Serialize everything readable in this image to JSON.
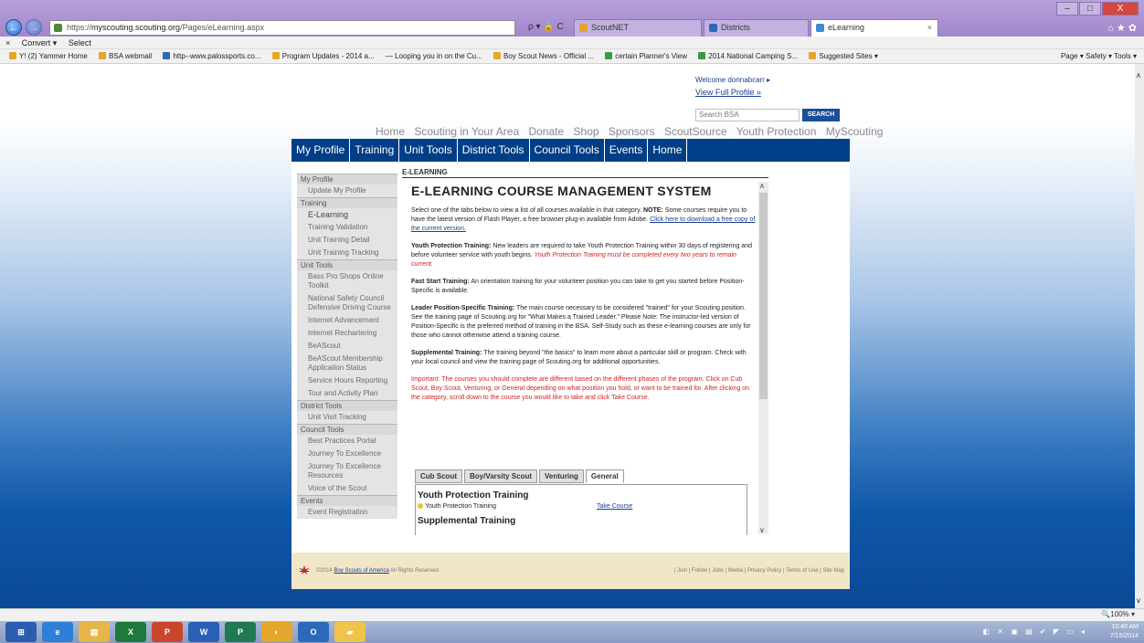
{
  "browser": {
    "url_prefix": "https://",
    "url_domain": "myscouting.scouting.org",
    "url_path": "/Pages/eLearning.aspx",
    "url_controls": "ρ ▾ 🔒 C",
    "tabs": [
      {
        "label": "ScoutNET",
        "active": false
      },
      {
        "label": "Districts",
        "active": false
      },
      {
        "label": "eLearning",
        "active": true
      }
    ],
    "tab_close": "×",
    "right_icons": "⌂ ★ ✿",
    "back": "←",
    "forward": "→",
    "window_min": "–",
    "window_max": "□",
    "window_close": "X"
  },
  "commandbar": {
    "close": "×",
    "convert": "Convert ▾",
    "select": "Select"
  },
  "favorites": [
    "Y! (2) Yammer Home",
    "BSA webmail",
    "http--www.palossports.co...",
    "Program Updates - 2014 a...",
    "— Looping you in on the Cu...",
    "Boy Scout News - Official ...",
    "certain Planner's View",
    "2014 National Camping S...",
    "Suggested Sites ▾"
  ],
  "tools_right": "Page ▾  Safety ▾  Tools ▾",
  "header": {
    "welcome": "Welcome donnabcarr ▸",
    "view_profile": "View Full Profile »",
    "search_placeholder": "Search BSA",
    "search_button": "SEARCH"
  },
  "top_links": [
    "Home",
    "Scouting in Your Area",
    "Donate",
    "Shop",
    "Sponsors",
    "ScoutSource",
    "Youth Protection",
    "MyScouting"
  ],
  "main_nav": [
    "My Profile",
    "Training",
    "Unit Tools",
    "District Tools",
    "Council Tools",
    "Events",
    "Home"
  ],
  "sidebar": [
    {
      "type": "sec",
      "label": "My Profile"
    },
    {
      "type": "item",
      "label": "Update My Profile"
    },
    {
      "type": "sec",
      "label": "Training"
    },
    {
      "type": "item",
      "label": "E-Learning",
      "big": true
    },
    {
      "type": "item",
      "label": "Training Validation"
    },
    {
      "type": "item",
      "label": "Unit Training Detail"
    },
    {
      "type": "item",
      "label": "Unit Training Tracking"
    },
    {
      "type": "sec",
      "label": "Unit Tools"
    },
    {
      "type": "item",
      "label": "Bass Pro Shops Online Toolkit"
    },
    {
      "type": "item",
      "label": "National Safety Council Defensive Driving Course"
    },
    {
      "type": "item",
      "label": "Internet Advancement"
    },
    {
      "type": "item",
      "label": "Internet Rechartering"
    },
    {
      "type": "item",
      "label": "BeAScout"
    },
    {
      "type": "item",
      "label": "BeAScout Membership Application Status"
    },
    {
      "type": "item",
      "label": "Service Hours Reporting"
    },
    {
      "type": "item",
      "label": "Tour and Activity Plan"
    },
    {
      "type": "sec",
      "label": "District Tools"
    },
    {
      "type": "item",
      "label": "Unit Visit Tracking"
    },
    {
      "type": "sec",
      "label": "Council Tools"
    },
    {
      "type": "item",
      "label": "Best Practices Portal"
    },
    {
      "type": "item",
      "label": "Journey To Excellence"
    },
    {
      "type": "item",
      "label": "Journey To Excellence Resources"
    },
    {
      "type": "item",
      "label": "Voice of the Scout"
    },
    {
      "type": "sec",
      "label": "Events"
    },
    {
      "type": "item",
      "label": "Event Registration"
    }
  ],
  "content": {
    "breadcrumb": "E-LEARNING",
    "title": "E-LEARNING COURSE MANAGEMENT SYSTEM",
    "intro_1": "Select one of the tabs below to view a list of all courses available in that category. ",
    "intro_note": "NOTE:",
    "intro_2": " Some courses require you to have the latest version of Flash Player, a free browser plug-in available from Adobe. ",
    "intro_link": "Click here to download a free copy of the current version.",
    "ypt_label": "Youth Protection Training:",
    "ypt_text": " New leaders are required to take Youth Protection Training within 30 days of registering and before volunteer service with youth begins. ",
    "ypt_red": "Youth Protection Training must be completed every two years to remain current.",
    "fst_label": "Fast Start Training:",
    "fst_text": " An orientation training for your volunteer position you can take to get you started before Position-Specific is available.",
    "lps_label": "Leader Position-Specific Training:",
    "lps_text": " The main course necessary to be considered \"trained\" for your Scouting position. See the training page of Scouting.org for \"What Makes a Trained Leader.\" Please Note: The instructor-led version of Position-Specific is the preferred method of training in the BSA. Self-Study such as these e-learning courses are only for those who cannot otherwise attend a training course.",
    "sup_label": "Supplemental Training:",
    "sup_text": " The training beyond \"the basics\" to learn more about a particular skill or program. Check with your local council and view the training page of Scouting.org for additional opportunities.",
    "important": "Important: The courses you should complete are different based on the different phases of the program. Click on Cub Scout, Boy Scout, Venturing, or General depending on what position you hold, or want to be trained for. After clicking on the category, scroll down to the course you would like to take and click Take Course."
  },
  "course_tabs": [
    {
      "label": "Cub Scout",
      "active": false
    },
    {
      "label": "Boy/Varsity Scout",
      "active": false
    },
    {
      "label": "Venturing",
      "active": false
    },
    {
      "label": "General",
      "active": true
    }
  ],
  "panel": {
    "heading": "Youth Protection Training",
    "course_name": "Youth Protection Training",
    "take_course": "Take Course",
    "heading2": "Supplemental Training"
  },
  "scroll_glyphs": {
    "up": "∧",
    "down": "∨"
  },
  "footer": {
    "copy_prefix": "©2014 ",
    "copy_link": "Boy Scouts of America",
    "copy_suffix": "  All Rights Reserved",
    "links": "|  Join  |  Follow  |  Jobs  |  Media  |  Privacy Policy  |  Terms of Use  |  Site Map"
  },
  "status": {
    "zoom": "🔍100%  ▾"
  },
  "taskbar": [
    {
      "label": "⊞",
      "color": "#2a5fb0"
    },
    {
      "label": "e",
      "color": "#2e7fd8"
    },
    {
      "label": "▤",
      "color": "#e6b64a"
    },
    {
      "label": "X",
      "color": "#1d7a3c"
    },
    {
      "label": "P",
      "color": "#c8472a"
    },
    {
      "label": "W",
      "color": "#2b5fb5"
    },
    {
      "label": "P",
      "color": "#1f7a4f"
    },
    {
      "label": "◐",
      "color": "#e6a629"
    },
    {
      "label": "O",
      "color": "#2a6ab8"
    },
    {
      "label": "▰",
      "color": "#f0c34a"
    }
  ],
  "tray": {
    "icons": "◧ ✕ ▣ ▤ ✔ ◤ ▭ ◂",
    "time": "10:40 AM",
    "date": "7/15/2014"
  }
}
